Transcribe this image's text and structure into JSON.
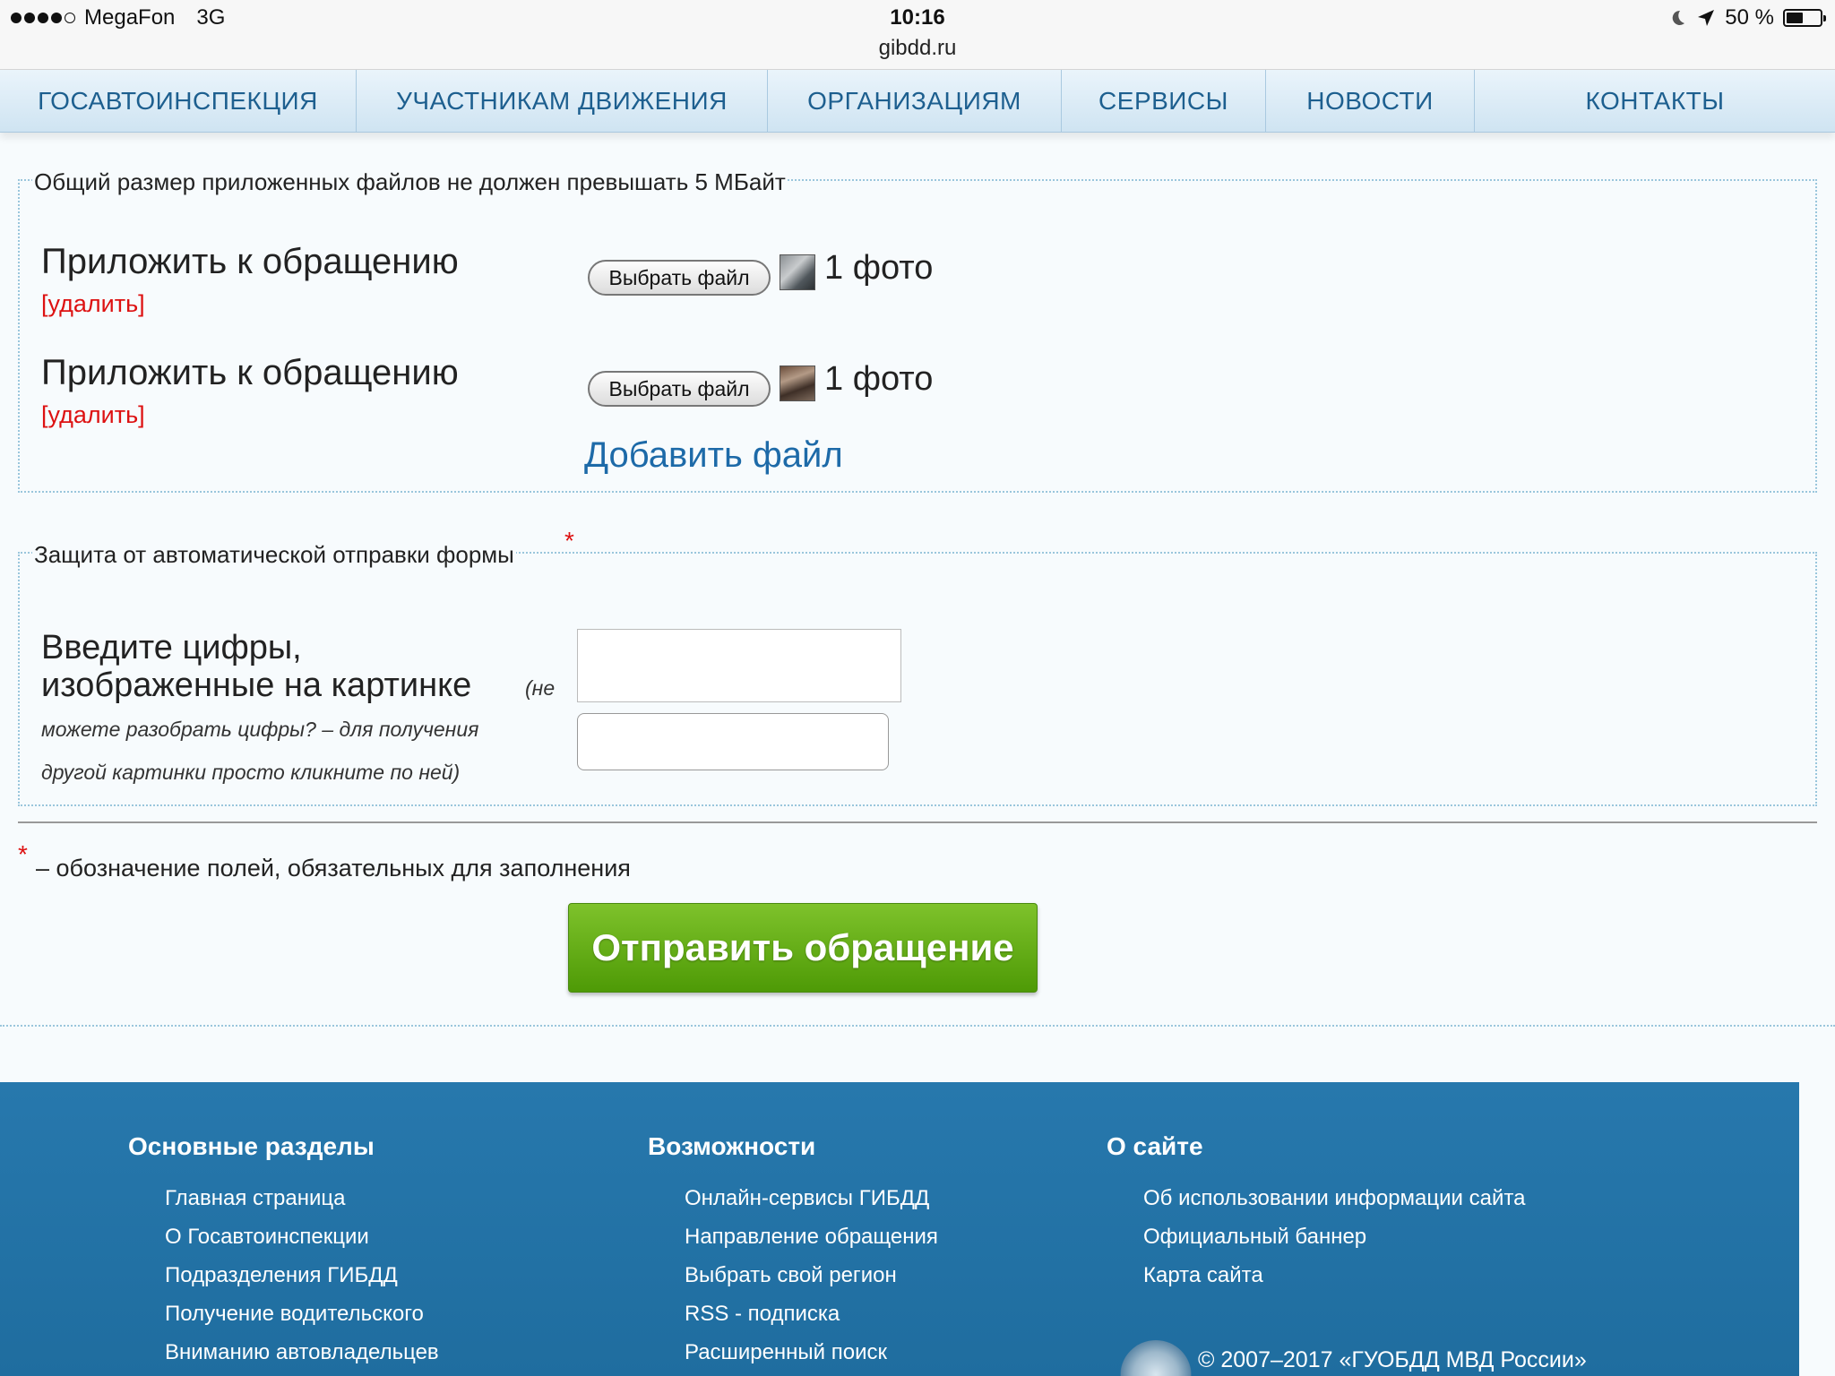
{
  "status_bar": {
    "carrier": "MegaFon",
    "network": "3G",
    "time": "10:16",
    "url": "gibdd.ru",
    "battery": "50 %",
    "battery_level": 0.5,
    "icons": [
      "signal-icon",
      "moon-icon",
      "location-arrow-icon",
      "battery-icon"
    ]
  },
  "nav": {
    "items": [
      {
        "label": "ГОСАВТОИНСПЕКЦИЯ"
      },
      {
        "label": "УЧАСТНИКАМ ДВИЖЕНИЯ"
      },
      {
        "label": "ОРГАНИЗАЦИЯМ"
      },
      {
        "label": "СЕРВИСЫ"
      },
      {
        "label": "НОВОСТИ"
      },
      {
        "label": "КОНТАКТЫ"
      }
    ]
  },
  "attachments": {
    "legend": "Общий размер приложенных файлов не должен превышать 5 МБайт",
    "rows": [
      {
        "label": "Приложить к обращению",
        "delete_label": "[удалить]",
        "button_label": "Выбрать файл",
        "count_label": "1 фото"
      },
      {
        "label": "Приложить к обращению",
        "delete_label": "[удалить]",
        "button_label": "Выбрать файл",
        "count_label": "1 фото"
      }
    ],
    "add_file_label": "Добавить файл"
  },
  "captcha": {
    "legend": "Защита от автоматической отправки формы",
    "required_mark": "*",
    "label_line1": "Введите цифры,",
    "label_line2": "изображенные на картинке",
    "hint_start": "(не",
    "hint_line2": "можете разобрать цифры? – для получения",
    "hint_line3": "другой картинки просто кликните по ней)",
    "input_value": ""
  },
  "required_note": {
    "mark": "*",
    "text": "– обозначение полей, обязательных для заполнения"
  },
  "submit_label": "Отправить обращение",
  "footer": {
    "columns": [
      {
        "heading": "Основные разделы",
        "items": [
          "Главная страница",
          "О Госавтоинспекции",
          "Подразделения ГИБДД",
          "Получение водительского",
          "Вниманию автовладельцев"
        ]
      },
      {
        "heading": "Возможности",
        "items": [
          "Онлайн-сервисы ГИБДД",
          "Направление обращения",
          "Выбрать свой регион",
          "RSS - подписка",
          "Расширенный поиск"
        ]
      },
      {
        "heading": "О сайте",
        "items": [
          "Об использовании информации сайта",
          "Официальный баннер",
          "Карта сайта"
        ]
      }
    ],
    "copyright": "© 2007–2017 «ГУОБДД МВД России»"
  }
}
